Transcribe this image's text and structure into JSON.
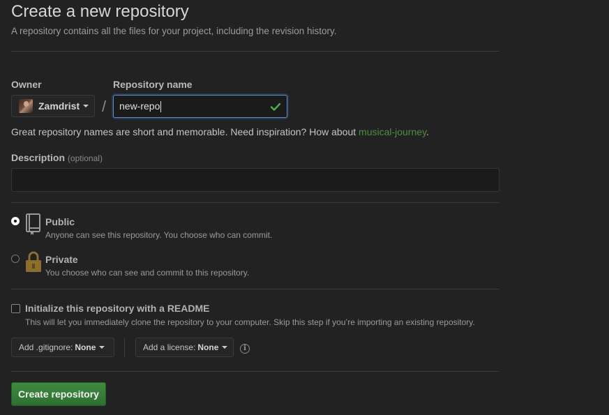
{
  "header": {
    "title": "Create a new repository",
    "subtitle": "A repository contains all the files for your project, including the revision history."
  },
  "owner": {
    "label": "Owner",
    "value": "Zamdrist"
  },
  "separator": "/",
  "repo_name": {
    "label": "Repository name",
    "value": "new-repo"
  },
  "hint": {
    "text": "Great repository names are short and memorable. Need inspiration? How about ",
    "suggestion": "musical-journey",
    "end": "."
  },
  "description": {
    "label": "Description",
    "optional": "(optional)",
    "value": ""
  },
  "visibility": {
    "public": {
      "title": "Public",
      "desc": "Anyone can see this repository. You choose who can commit.",
      "selected": true
    },
    "private": {
      "title": "Private",
      "desc": "You choose who can see and commit to this repository.",
      "selected": false
    }
  },
  "readme": {
    "title": "Initialize this repository with a README",
    "desc": "This will let you immediately clone the repository to your computer. Skip this step if you’re importing an existing repository.",
    "checked": false
  },
  "gitignore": {
    "label": "Add .gitignore:",
    "value": "None"
  },
  "license": {
    "label": "Add a license:",
    "value": "None"
  },
  "submit": {
    "label": "Create repository"
  },
  "colors": {
    "background": "#222222",
    "accent_green": "#2e6f30",
    "suggestion": "#4e8f3c",
    "focus_border": "#5a8fcf"
  },
  "icons": {
    "repo_public": "book-icon",
    "repo_private": "lock-icon",
    "valid": "check-icon",
    "info": "info-icon"
  }
}
